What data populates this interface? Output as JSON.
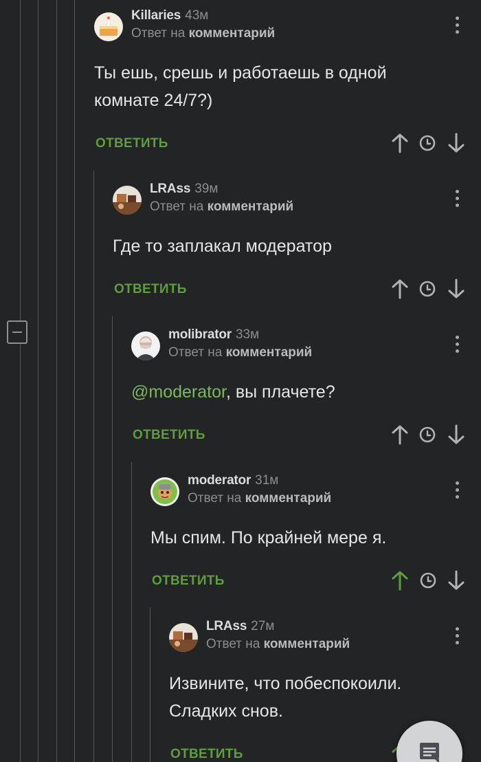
{
  "reply_prefix": "Ответ на",
  "reply_target": "комментарий",
  "reply_label": "ОТВЕТИТЬ",
  "comments": [
    {
      "author": "Killaries",
      "age": "43м",
      "text_lines": [
        "Ты ешь, срешь и работаешь в одной",
        "комнате 24/7?)"
      ],
      "upvoted": false,
      "avatar_icon": "cake-avatar-icon"
    },
    {
      "author": "LRAss",
      "age": "39м",
      "text_lines": [
        "Где то заплакал модератор"
      ],
      "upvoted": false,
      "avatar_icon": "desk-avatar-icon"
    },
    {
      "author": "molibrator",
      "age": "33м",
      "mention": "@moderator",
      "text_after_mention": ", вы плачете?",
      "upvoted": false,
      "avatar_icon": "man-portrait-avatar-icon"
    },
    {
      "author": "moderator",
      "age": "31м",
      "text_lines": [
        "Мы спим. По крайней мере я."
      ],
      "upvoted": true,
      "avatar_icon": "knight-avatar-icon"
    },
    {
      "author": "LRAss",
      "age": "27м",
      "text_lines": [
        "Извините, что побеспокоили.",
        "Сладких снов."
      ],
      "upvoted": true,
      "avatar_icon": "desk-avatar-icon"
    }
  ],
  "colors": {
    "background": "#222426",
    "accent_green": "#5f9e3f",
    "mention_green": "#7cb85e",
    "text": "#e6e6e6",
    "muted": "#8b8e91"
  },
  "icons": {
    "upvote": "arrow-up-icon",
    "history": "clock-icon",
    "downvote": "arrow-down-icon",
    "more": "more-vertical-icon",
    "collapse": "minus-square-icon",
    "fab": "comment-list-icon"
  }
}
